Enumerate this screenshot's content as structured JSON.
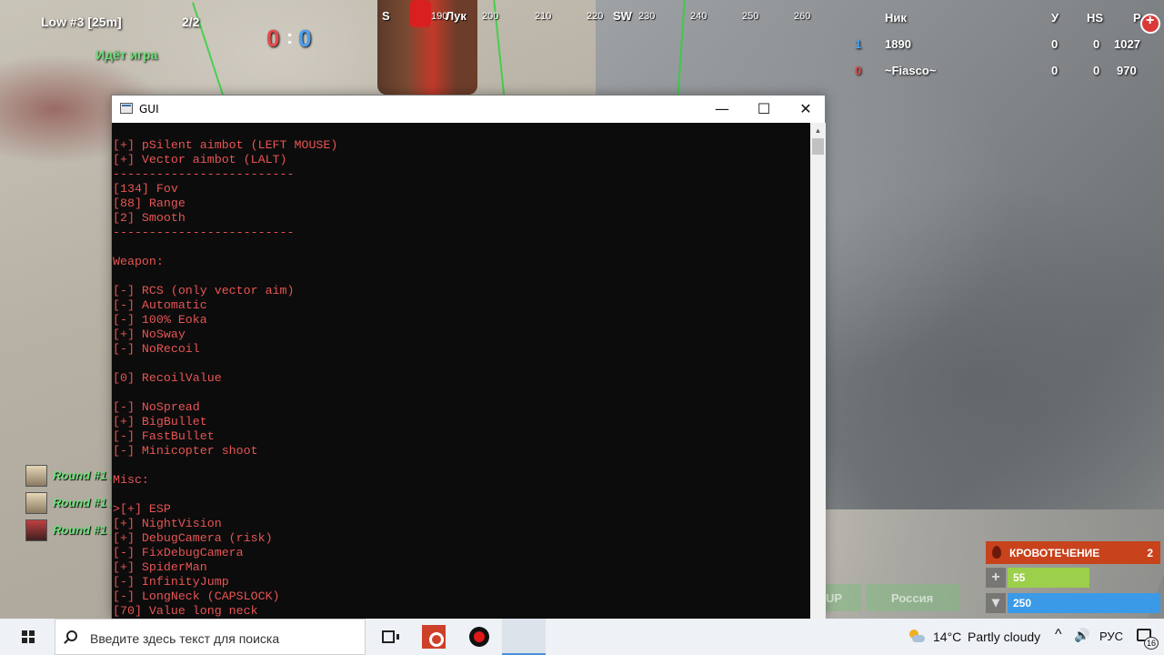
{
  "hud": {
    "server": "Low #3 [25m]",
    "round": "2/2",
    "status": "Идёт игра",
    "score_red": "0",
    "score_sep": ":",
    "score_blue": "0",
    "compass": [
      {
        "label": "S",
        "major": true
      },
      {
        "label": "190"
      },
      {
        "label": "Лук",
        "major": true
      },
      {
        "label": "200"
      },
      {
        "label": "210"
      },
      {
        "label": "220"
      },
      {
        "label": "SW",
        "major": true
      },
      {
        "label": "230"
      },
      {
        "label": "240"
      },
      {
        "label": "250"
      },
      {
        "label": "260"
      }
    ]
  },
  "scoreboard": {
    "headers": {
      "name": "Ник",
      "kills": "У",
      "hs": "HS",
      "points": "Р"
    },
    "rows": [
      {
        "idx": "1",
        "name": "1890",
        "kills": "0",
        "hs": "0",
        "points": "1027",
        "idx_color": "#4aa0f0"
      },
      {
        "idx": "0",
        "name": "~Fiasco~",
        "kills": "0",
        "hs": "0",
        "points": "970",
        "idx_color": "#e84a4a"
      }
    ]
  },
  "feed": [
    {
      "label": "Round #1 /",
      "avatar": "light"
    },
    {
      "label": "Round #1 /",
      "avatar": "light"
    },
    {
      "label": "Round #1 /",
      "avatar": "red"
    }
  ],
  "status": {
    "bleeding_label": "КРОВОТЕЧЕНИЕ",
    "bleeding_value": "2",
    "health": "55",
    "health_color": "#9ccf4a",
    "food": "250",
    "food_color": "#3a9ae8",
    "bg_btn_1": "UP",
    "bg_btn_2": "Россия"
  },
  "window": {
    "title": "GUI",
    "minimize": "—",
    "maximize": "☐",
    "close": "✕",
    "console_lines": [
      "[+] pSilent aimbot (LEFT MOUSE)",
      "[+] Vector aimbot (LALT)",
      "-------------------------",
      "[134] Fov",
      "[88] Range",
      "[2] Smooth",
      "-------------------------",
      "",
      "Weapon:",
      "",
      "[-] RCS (only vector aim)",
      "[-] Automatic",
      "[-] 100% Eoka",
      "[+] NoSway",
      "[-] NoRecoil",
      "",
      "[0] RecoilValue",
      "",
      "[-] NoSpread",
      "[+] BigBullet",
      "[-] FastBullet",
      "[-] Minicopter shoot",
      "",
      "Misc:",
      "",
      ">[+] ESP",
      "[+] NightVision",
      "[+] DebugCamera (risk)",
      "[-] FixDebugCamera",
      "[+] SpiderMan",
      "[-] InfinityJump",
      "[-] LongNeck (CAPSLOCK)",
      "[70] Value long neck"
    ],
    "console_color": "#e85454"
  },
  "taskbar": {
    "search_placeholder": "Введите здесь текст для поиска",
    "temperature": "14°C",
    "weather": "Partly cloudy",
    "lang": "РУС",
    "notif_count": "16",
    "chevron": "^",
    "volume": "🔊"
  }
}
